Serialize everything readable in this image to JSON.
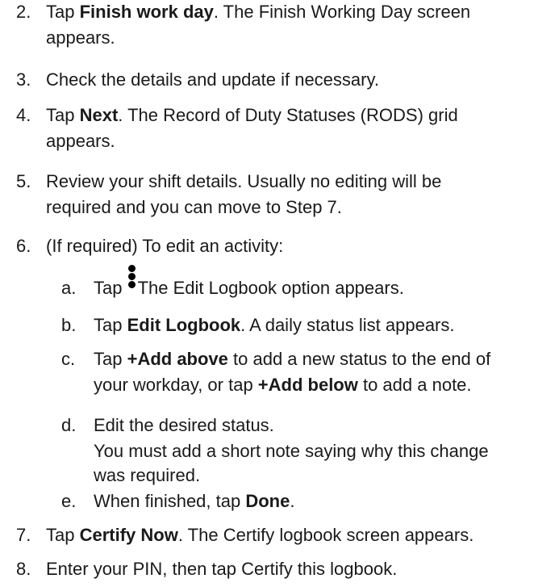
{
  "steps": [
    {
      "num": "2.",
      "a": "Tap ",
      "b": "Finish work day",
      "c": ". The Finish Working Day screen",
      "d": "appears."
    },
    {
      "num": "3.",
      "a": "Check the details and update if necessary."
    },
    {
      "num": "4.",
      "a": "Tap ",
      "b": "Next",
      "c": ". The Record of Duty Statuses (RODS) grid",
      "d": "appears."
    },
    {
      "num": "5.",
      "a": "Review your shift details. Usually no editing will be",
      "d": "required and you can move to Step 7."
    },
    {
      "num": "6.",
      "a": "(If required) To edit an activity:"
    },
    {
      "num": "7.",
      "a": "Tap ",
      "b": "Certify Now",
      "c": ". The Certify logbook screen appears."
    },
    {
      "num": "8.",
      "a": "Enter your PIN, then tap Certify this logbook."
    }
  ],
  "substeps": [
    {
      "letter": "a.",
      "a": "Tap ",
      "icon": "vertical-ellipsis-icon",
      "c": "The Edit Logbook option appears."
    },
    {
      "letter": "b.",
      "a": "Tap ",
      "b": "Edit Logbook",
      "c": ". A daily status list appears."
    },
    {
      "letter": "c.",
      "a": "Tap ",
      "b": "+Add above",
      "c": " to add a new status to the end of",
      "l2a": "your workday, or tap ",
      "l2b": "+Add below",
      "l2c": " to add a note."
    },
    {
      "letter": "d.",
      "a": "Edit the desired status.",
      "l2a": "You must add a short note saying why this change",
      "l3a": "was required."
    },
    {
      "letter": "e.",
      "a": "When finished, tap ",
      "b": "Done",
      "c": "."
    }
  ]
}
